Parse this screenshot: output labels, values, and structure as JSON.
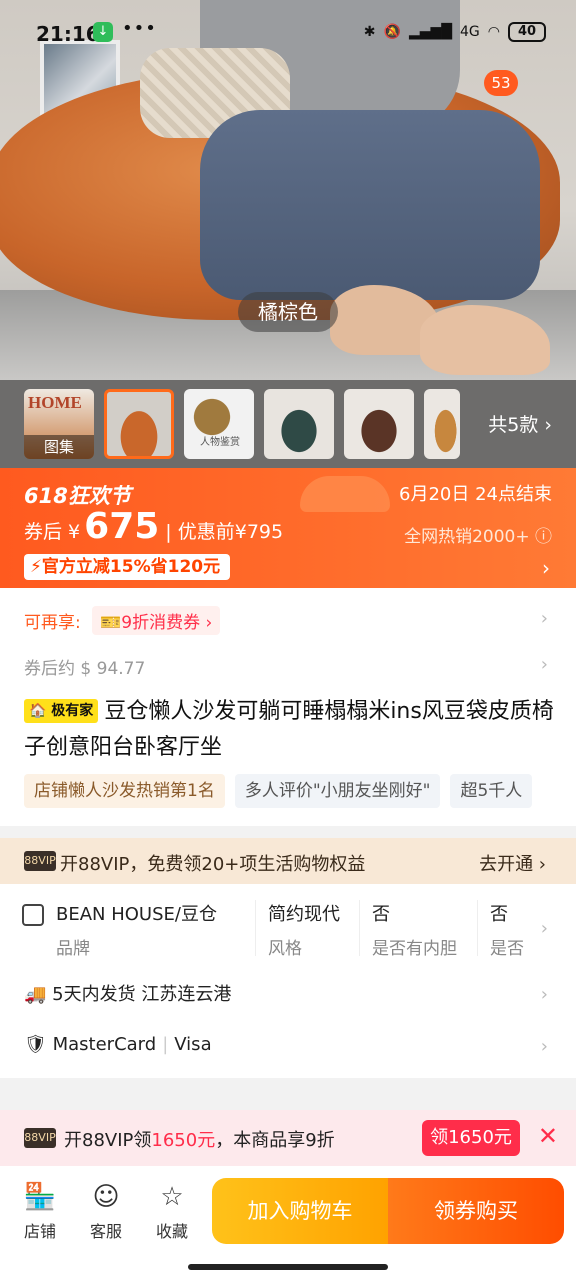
{
  "status": {
    "time": "21:16",
    "dots": "•••",
    "signal": "4G",
    "battery": "40"
  },
  "hero": {
    "color_label": "橘棕色",
    "badge": "53"
  },
  "thumbs": {
    "first_label": "图集",
    "home_text": "HOME",
    "third_text": "人物鉴赏",
    "more": "共5款 ›"
  },
  "promo": {
    "festival": "618狂欢节",
    "end_time": "6月20日 24点结束",
    "price_prefix": "券后 ¥",
    "price": "675",
    "orig_price": "| 优惠前¥795",
    "sales": "全网热销2000+ ⓘ",
    "discount_tag": "⚡官方立减15%省120元",
    "chevron": "›"
  },
  "coupon": {
    "label": "可再享:",
    "coupon": "🎫9折消费券 ›"
  },
  "after_price": "券后约 $ 94.77",
  "product": {
    "brand_tag": "🏠 极有家",
    "title": "豆仓懒人沙发可躺可睡榻榻米ins风豆袋皮质椅子创意阳台卧客厅坐",
    "chips": [
      "店铺懒人沙发热销第1名",
      "多人评价\"小朋友坐刚好\"",
      "超5千人"
    ]
  },
  "vip": {
    "icon": "88VIP",
    "text": "开88VIP，免费领20+项生活购物权益",
    "go": "去开通 ›"
  },
  "specs": {
    "attrs": [
      {
        "value": "BEAN HOUSE/豆仓",
        "key": "品牌"
      },
      {
        "value": "简约现代",
        "key": "风格"
      },
      {
        "value": "否",
        "key": "是否有内胆"
      },
      {
        "value": "否",
        "key": "是否"
      }
    ],
    "shipping": "5天内发货  江苏连云港",
    "pay1": "MasterCard",
    "pay2": "Visa"
  },
  "vip_banner": {
    "icon": "88VIP",
    "pre": "开88VIP领",
    "amount": "1650元",
    "post": "，本商品享9折",
    "button": "领1650元",
    "close": "✕"
  },
  "bottom": {
    "shop": "店铺",
    "service": "客服",
    "fav": "收藏",
    "cart": "加入购物车",
    "buy": "领券购买"
  },
  "colors": {
    "accent": "#ff5a1f",
    "vip_red": "#ff2d4a",
    "cart_yellow": "#ffb100"
  }
}
